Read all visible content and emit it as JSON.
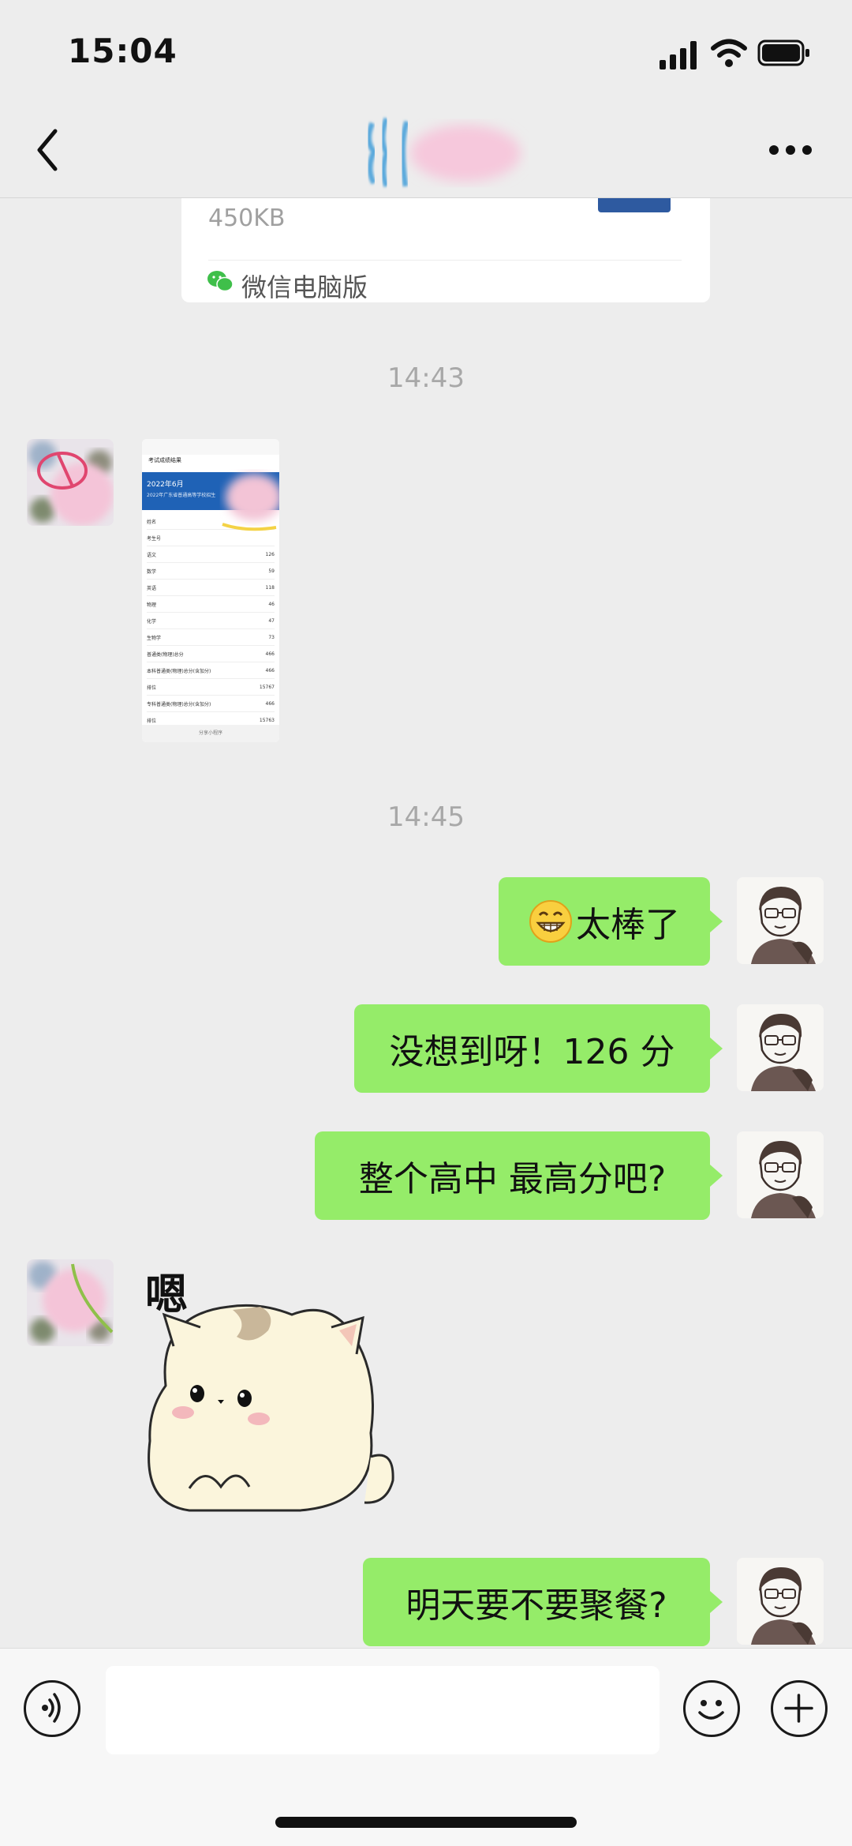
{
  "status_bar": {
    "time": "15:04",
    "icons": [
      "signal-icon",
      "wifi-icon",
      "battery-icon"
    ]
  },
  "nav": {
    "back_icon": "chevron-left-icon",
    "title_blurred": true,
    "more_icon": "more-dots-icon"
  },
  "file_card": {
    "size": "450KB",
    "source": "微信电脑版",
    "source_icon": "wechat-icon"
  },
  "timestamps": [
    "14:43",
    "14:45"
  ],
  "messages": [
    {
      "side": "left",
      "type": "image",
      "content": "screenshot-thumbnail"
    },
    {
      "side": "right",
      "type": "text",
      "emoji": "grinning-face-icon",
      "text": "太棒了"
    },
    {
      "side": "right",
      "type": "text",
      "text": "没想到呀！126 分"
    },
    {
      "side": "right",
      "type": "text",
      "text": "整个高中 最高分吧?"
    },
    {
      "side": "left",
      "type": "sticker",
      "caption": "嗯",
      "content": "cat-sticker"
    },
    {
      "side": "right",
      "type": "text",
      "text": "明天要不要聚餐?"
    }
  ],
  "thumbnail": {
    "header": "考试成绩结果",
    "banner": "2022年6月",
    "banner_sub": "2022年广东省普通高等学校招生",
    "rows": [
      {
        "label": "姓名",
        "value": ""
      },
      {
        "label": "考生号",
        "value": ""
      },
      {
        "label": "语文",
        "value": "126"
      },
      {
        "label": "数学",
        "value": "59"
      },
      {
        "label": "英语",
        "value": "118"
      },
      {
        "label": "物理",
        "value": "46"
      },
      {
        "label": "化学",
        "value": "47"
      },
      {
        "label": "生物学",
        "value": "73"
      },
      {
        "label": "普通类(物理)总分",
        "value": "466"
      },
      {
        "label": "本科普通类(物理)总分(含加分)",
        "value": "466"
      },
      {
        "label": "排位",
        "value": "15767"
      },
      {
        "label": "专科普通类(物理)总分(含加分)",
        "value": "466"
      },
      {
        "label": "排位",
        "value": "15763"
      }
    ],
    "footer": "分享小程序"
  },
  "input_bar": {
    "voice_icon": "voice-icon",
    "emoji_icon": "emoji-icon",
    "plus_icon": "plus-icon"
  },
  "colors": {
    "background": "#ededed",
    "bubble_green": "#95ec69",
    "card_white": "#ffffff",
    "timestamp_gray": "#a8a8a8"
  }
}
